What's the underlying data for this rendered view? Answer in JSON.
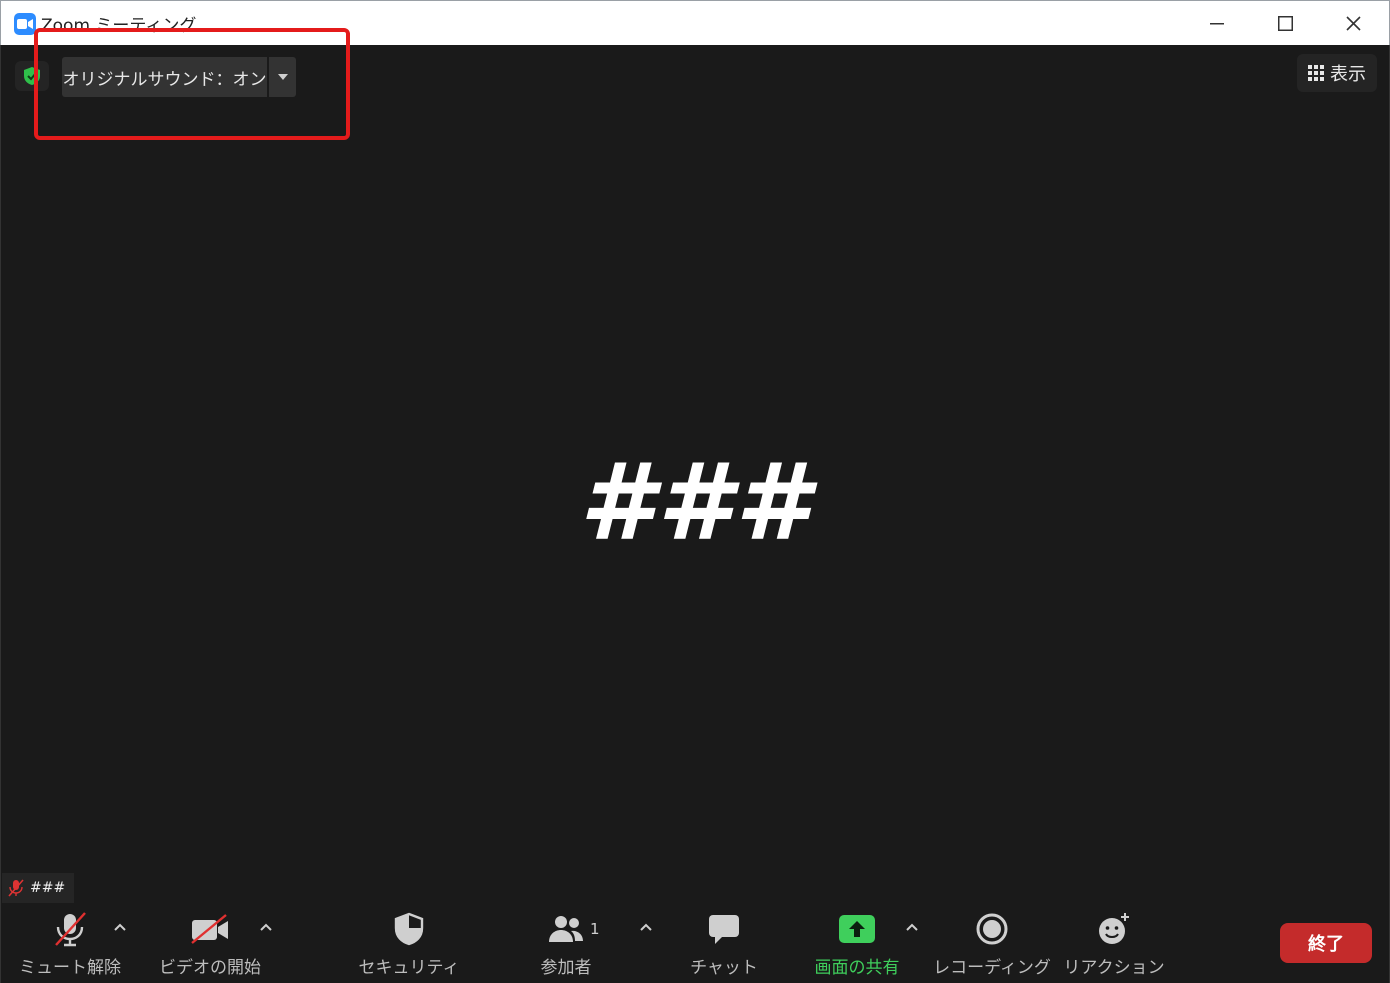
{
  "window": {
    "title": "Zoom ミーティング"
  },
  "top_controls": {
    "original_sound_label": "オリジナルサウンド：オン",
    "view_label": "表示"
  },
  "video": {
    "participant_display": "###"
  },
  "name_tag": {
    "name": "###"
  },
  "toolbar": {
    "unmute_label": "ミュート解除",
    "start_video_label": "ビデオの開始",
    "security_label": "セキュリティ",
    "participants_label": "参加者",
    "participants_count": "1",
    "chat_label": "チャット",
    "share_screen_label": "画面の共有",
    "recording_label": "レコーディング",
    "reactions_label": "リアクション",
    "end_label": "終了"
  },
  "colors": {
    "background": "#1a1a1a",
    "share_green": "#3fcf5c",
    "end_red": "#c42b2b",
    "highlight_red": "#e41b1b",
    "zoom_blue": "#2d8cff"
  }
}
